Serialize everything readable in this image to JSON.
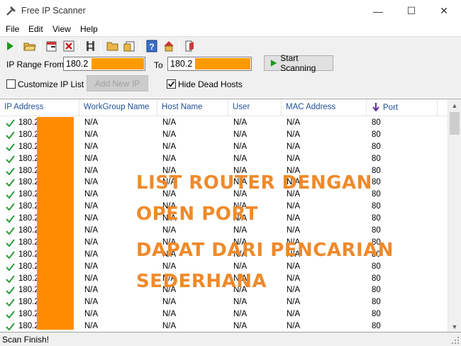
{
  "window": {
    "title": "Free IP Scanner",
    "minimize_glyph": "—",
    "maximize_glyph": "☐",
    "close_glyph": "✕"
  },
  "menu": [
    "File",
    "Edit",
    "View",
    "Help"
  ],
  "toolbar_icons": [
    "play-icon",
    "open-folder-icon",
    "export-icon",
    "stop-icon",
    "network-icon",
    "folder-icon",
    "clipboard-icon",
    "help-icon",
    "home-icon",
    "exit-icon"
  ],
  "range": {
    "label_from": "IP Range From",
    "from_value": "180.2",
    "label_to": "To",
    "to_value": "180.2"
  },
  "start_button": "Start Scanning",
  "customize_label": "Customize IP List",
  "add_new_ip": "Add New IP",
  "hide_dead_label": "Hide Dead Hosts",
  "hide_dead_checked": true,
  "customize_checked": false,
  "columns": [
    "IP Address",
    "WorkGroup Name",
    "Host Name",
    "User",
    "MAC Address",
    "Port"
  ],
  "rows": [
    {
      "ip": "180.2",
      "workgroup": "N/A",
      "host": "N/A",
      "user": "N/A",
      "mac": "N/A",
      "port": "80"
    },
    {
      "ip": "180.2",
      "workgroup": "N/A",
      "host": "N/A",
      "user": "N/A",
      "mac": "N/A",
      "port": "80"
    },
    {
      "ip": "180.2",
      "workgroup": "N/A",
      "host": "N/A",
      "user": "N/A",
      "mac": "N/A",
      "port": "80"
    },
    {
      "ip": "180.2",
      "workgroup": "N/A",
      "host": "N/A",
      "user": "N/A",
      "mac": "N/A",
      "port": "80"
    },
    {
      "ip": "180.2",
      "workgroup": "N/A",
      "host": "N/A",
      "user": "N/A",
      "mac": "N/A",
      "port": "80"
    },
    {
      "ip": "180.2",
      "workgroup": "N/A",
      "host": "N/A",
      "user": "N/A",
      "mac": "N/A",
      "port": "80"
    },
    {
      "ip": "180.2",
      "workgroup": "N/A",
      "host": "N/A",
      "user": "N/A",
      "mac": "N/A",
      "port": "80"
    },
    {
      "ip": "180.2",
      "workgroup": "N/A",
      "host": "N/A",
      "user": "N/A",
      "mac": "N/A",
      "port": "80"
    },
    {
      "ip": "180.2",
      "workgroup": "N/A",
      "host": "N/A",
      "user": "N/A",
      "mac": "N/A",
      "port": "80"
    },
    {
      "ip": "180.2",
      "workgroup": "N/A",
      "host": "N/A",
      "user": "N/A",
      "mac": "N/A",
      "port": "80"
    },
    {
      "ip": "180.2",
      "workgroup": "N/A",
      "host": "N/A",
      "user": "N/A",
      "mac": "N/A",
      "port": "80"
    },
    {
      "ip": "180.2",
      "workgroup": "N/A",
      "host": "N/A",
      "user": "N/A",
      "mac": "N/A",
      "port": "80"
    },
    {
      "ip": "180.2",
      "workgroup": "N/A",
      "host": "N/A",
      "user": "N/A",
      "mac": "N/A",
      "port": "80"
    },
    {
      "ip": "180.2",
      "workgroup": "N/A",
      "host": "N/A",
      "user": "N/A",
      "mac": "N/A",
      "port": "80"
    },
    {
      "ip": "180.2",
      "workgroup": "N/A",
      "host": "N/A",
      "user": "N/A",
      "mac": "N/A",
      "port": "80"
    },
    {
      "ip": "180.2",
      "workgroup": "N/A",
      "host": "N/A",
      "user": "N/A",
      "mac": "N/A",
      "port": "80"
    },
    {
      "ip": "180.2",
      "workgroup": "N/A",
      "host": "N/A",
      "user": "N/A",
      "mac": "N/A",
      "port": "80"
    },
    {
      "ip": "180.2",
      "workgroup": "N/A",
      "host": "N/A",
      "user": "N/A",
      "mac": "N/A",
      "port": "80"
    }
  ],
  "overlay_text": [
    "LIST ROUTER DENGAN",
    "OPEN PORT",
    "DAPAT DARI PENCARIAN",
    "SEDERHANA"
  ],
  "status": "Scan Finish!",
  "colors": {
    "overlay_text": "#ef8a2b",
    "redaction": "#ff8c00",
    "header_text": "#1f4e9a",
    "check_green": "#2e9a3a"
  }
}
